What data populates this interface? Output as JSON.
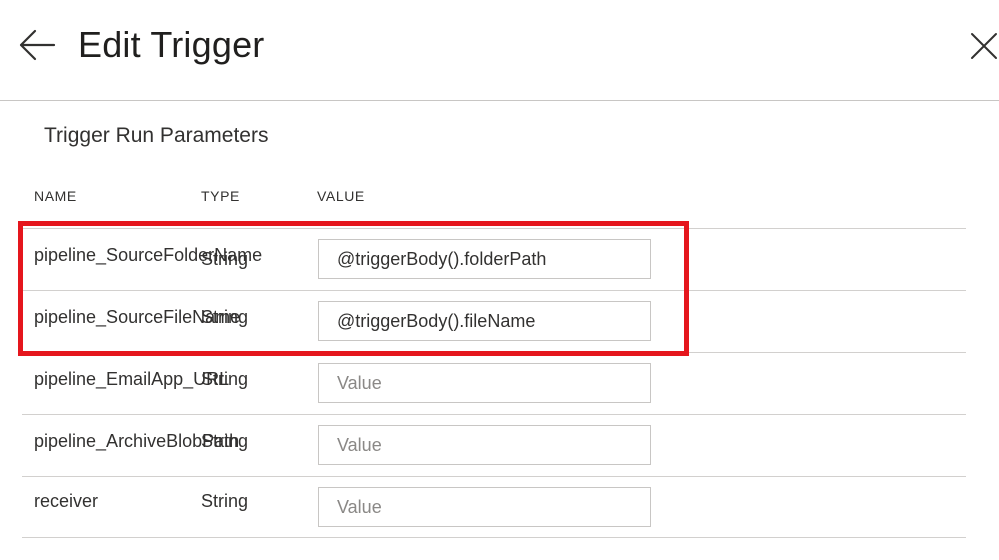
{
  "header": {
    "title": "Edit Trigger",
    "back_icon": "arrow-left-icon",
    "close_icon": "close-icon"
  },
  "section": {
    "title": "Trigger Run Parameters"
  },
  "table": {
    "columns": [
      "NAME",
      "TYPE",
      "VALUE"
    ],
    "rows": [
      {
        "name": "pipeline_SourceFolderName",
        "type": "String",
        "value": "@triggerBody().folderPath",
        "placeholder": ""
      },
      {
        "name": "pipeline_SourceFileName",
        "type": "String",
        "value": "@triggerBody().fileName",
        "placeholder": ""
      },
      {
        "name": "pipeline_EmailApp_URL",
        "type": "String",
        "value": "",
        "placeholder": "Value"
      },
      {
        "name": "pipeline_ArchiveBlobPath",
        "type": "String",
        "value": "",
        "placeholder": "Value"
      },
      {
        "name": "receiver",
        "type": "String",
        "value": "",
        "placeholder": "Value"
      }
    ]
  },
  "highlight": {
    "color": "#e5161d"
  }
}
